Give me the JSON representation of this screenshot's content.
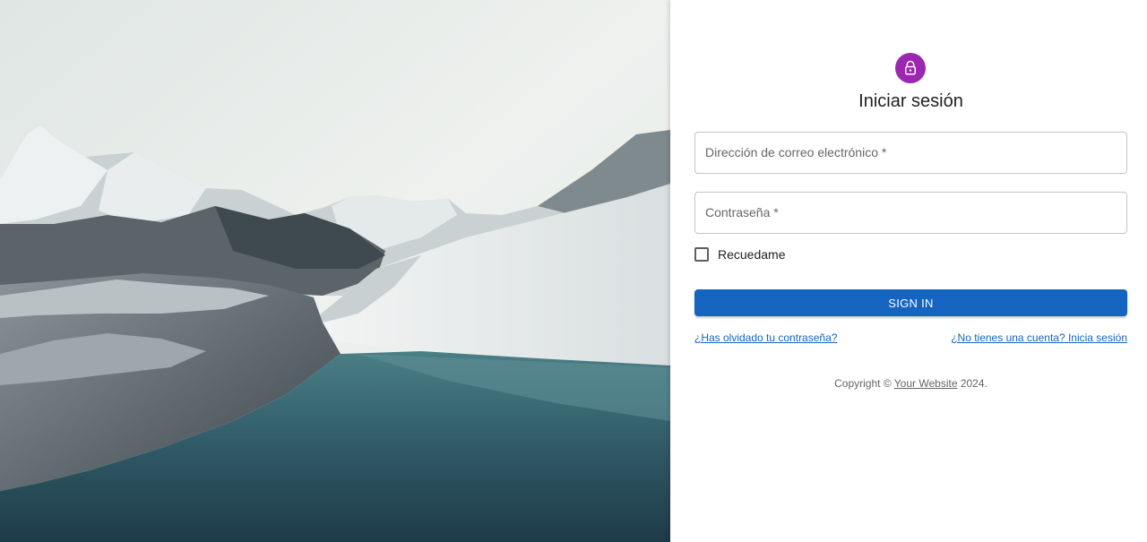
{
  "hero": {
    "image": "mountain-lake-landscape",
    "sky_color": "#e7ecea",
    "water_color": "#2c4d5a"
  },
  "login": {
    "icon": "lock-icon",
    "accent_color": "#9c27b0",
    "title": "Iniciar sesión",
    "email": {
      "label": "Dirección de correo electrónico *",
      "value": ""
    },
    "password": {
      "label": "Contraseña *",
      "value": ""
    },
    "remember_label": "Recuedame",
    "remember_checked": false,
    "submit_label": "SIGN IN",
    "submit_color": "#1565c0",
    "forgot_link": "¿Has olvidado tu contraseña?",
    "signup_link": "¿No tienes una cuenta? Inicia sesión"
  },
  "footer": {
    "copyright_prefix": "Copyright © ",
    "site_name": "Your Website",
    "copyright_suffix": " 2024."
  }
}
